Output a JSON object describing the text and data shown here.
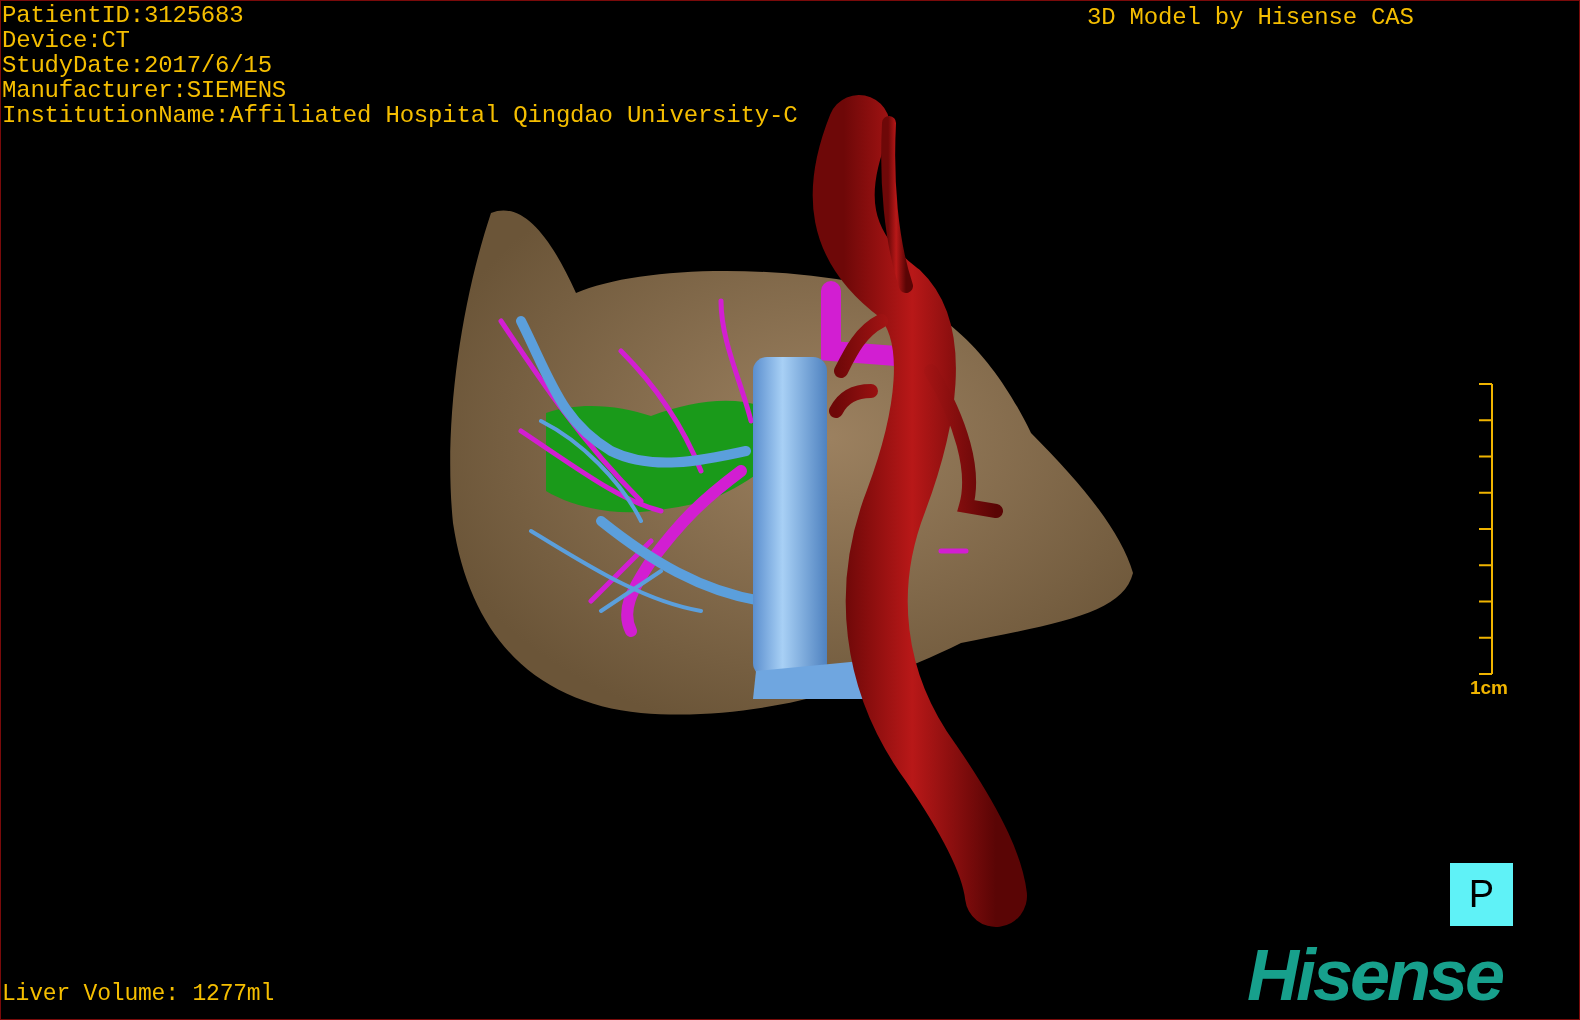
{
  "patient_info": [
    "PatientID:3125683",
    "Device:CT",
    "StudyDate:2017/6/15",
    "Manufacturer:SIEMENS",
    "InstitutionName:Affiliated Hospital Qingdao University-C"
  ],
  "title": "3D Model by Hisense CAS",
  "scale_bar": {
    "label": "1cm"
  },
  "orientation_marker": "P",
  "liver_volume": "Liver Volume: 1277ml",
  "logo": "Hisense"
}
